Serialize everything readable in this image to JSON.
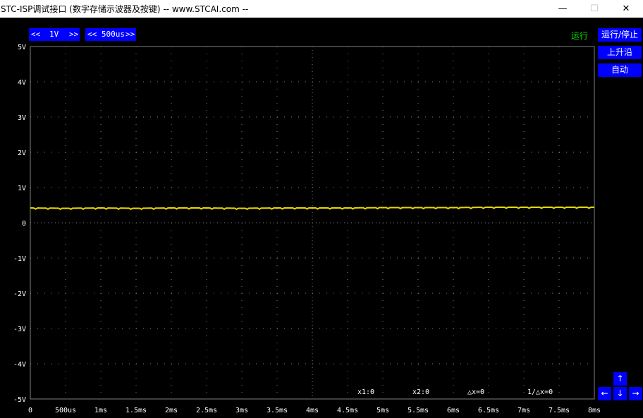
{
  "window": {
    "title": "STC-ISP调试接口 (数字存储示波器及按键) -- www.STCAI.com --",
    "minimize_glyph": "—",
    "maximize_glyph": "☐",
    "close_glyph": "✕"
  },
  "controls": {
    "volt_left": "<<",
    "volt_value": "1V",
    "volt_right": ">>",
    "time_left": "<< 500us",
    "time_right": ">>",
    "status": "运行",
    "run_stop": "运行/停止",
    "rising_edge": "上升沿",
    "auto": "自动"
  },
  "arrows": {
    "up": "↑",
    "left": "←",
    "down": "↓",
    "right": "→"
  },
  "measurements": {
    "x1": "x1:0",
    "x2": "x2:0",
    "dx": "△x=0",
    "inv_dx": "1/△x=0"
  },
  "colors": {
    "trace": "#e8d800",
    "grid": "#808080",
    "button": "#0000ff",
    "status": "#00e000"
  },
  "chart_data": {
    "type": "line",
    "ylim": [
      -5,
      5
    ],
    "xlim": [
      0,
      8
    ],
    "y_ticks": [
      "5V",
      "4V",
      "3V",
      "2V",
      "1V",
      "0",
      "-1V",
      "-2V",
      "-3V",
      "-4V",
      "-5V"
    ],
    "x_ticks": [
      "0",
      "500us",
      "1ms",
      "1.5ms",
      "2ms",
      "2.5ms",
      "3ms",
      "3.5ms",
      "4ms",
      "4.5ms",
      "5ms",
      "5.5ms",
      "6ms",
      "6.5ms",
      "7ms",
      "7.5ms",
      "8ms"
    ],
    "grid": true,
    "series": [
      {
        "values_x": [
          0,
          0.5,
          1,
          1.5,
          2,
          2.5,
          3,
          3.5,
          4,
          4.5,
          5,
          5.5,
          6,
          6.5,
          7,
          7.5,
          8
        ],
        "values_y": [
          0.42,
          0.41,
          0.42,
          0.41,
          0.42,
          0.42,
          0.41,
          0.42,
          0.42,
          0.42,
          0.43,
          0.43,
          0.43,
          0.44,
          0.44,
          0.44,
          0.44
        ]
      }
    ]
  }
}
